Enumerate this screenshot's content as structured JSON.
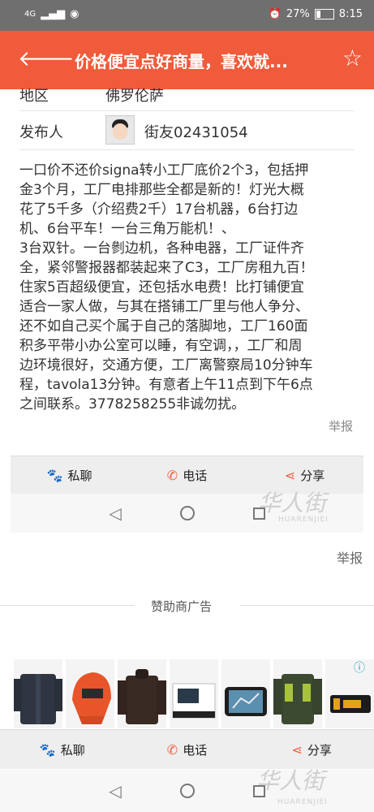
{
  "status_bar": {
    "network": "4G",
    "battery_percent": 27,
    "battery_text": "27%",
    "time": "8:15"
  },
  "app_bar": {
    "title": "价格便宜点好商量，喜欢就..."
  },
  "details": {
    "region_label": "地区",
    "region_value": "佛罗伦萨",
    "poster_label": "发布人",
    "poster_name": "街友02431054"
  },
  "description_lines": [
    "一口价不还价signa转小工厂底价2个3，包括押",
    "金3个月，工厂电排那些全都是新的！灯光大概",
    "花了5千多（介绍费2千）17台机器，6台打边",
    "机、6台平车！一台三角万能机！、",
    "3台双针。一台剼边机，各种电器，工厂证件齐",
    "全，紧邻警报器都装起来了C3，工厂房租九百！",
    "住家5百超级便宜，还包括水电费！比打铺便宜",
    "适合一家人做，与其在搭铺工厂里与他人争分、",
    "还不如自己买个属于自己的落脚地，工厂160面",
    "积多平带小办公室可以睡，有空调，，工厂和周",
    "边环境很好，交通方便，工厂离警察局10分钟车",
    "程，tavola13分钟。有意者上午11点到下午6点",
    "之间联系。3778258255非诚勿扰。"
  ],
  "report_label": "举报",
  "report_label_2": "举报",
  "actions": {
    "chat": "私聊",
    "phone": "电话",
    "share": "分享"
  },
  "watermark": {
    "cn": "华人街",
    "en": "HUARENJIEI"
  },
  "sponsor_label": "赞助商广告",
  "icons": {
    "back": "arrow-left-icon",
    "favorite": "star-icon",
    "chat": "paw-icon",
    "phone": "phone-icon",
    "share": "share-icon"
  },
  "colors": {
    "accent": "#ef5b3b",
    "status_bar": "#6f6f6f",
    "action_bar": "#eeeeee"
  }
}
